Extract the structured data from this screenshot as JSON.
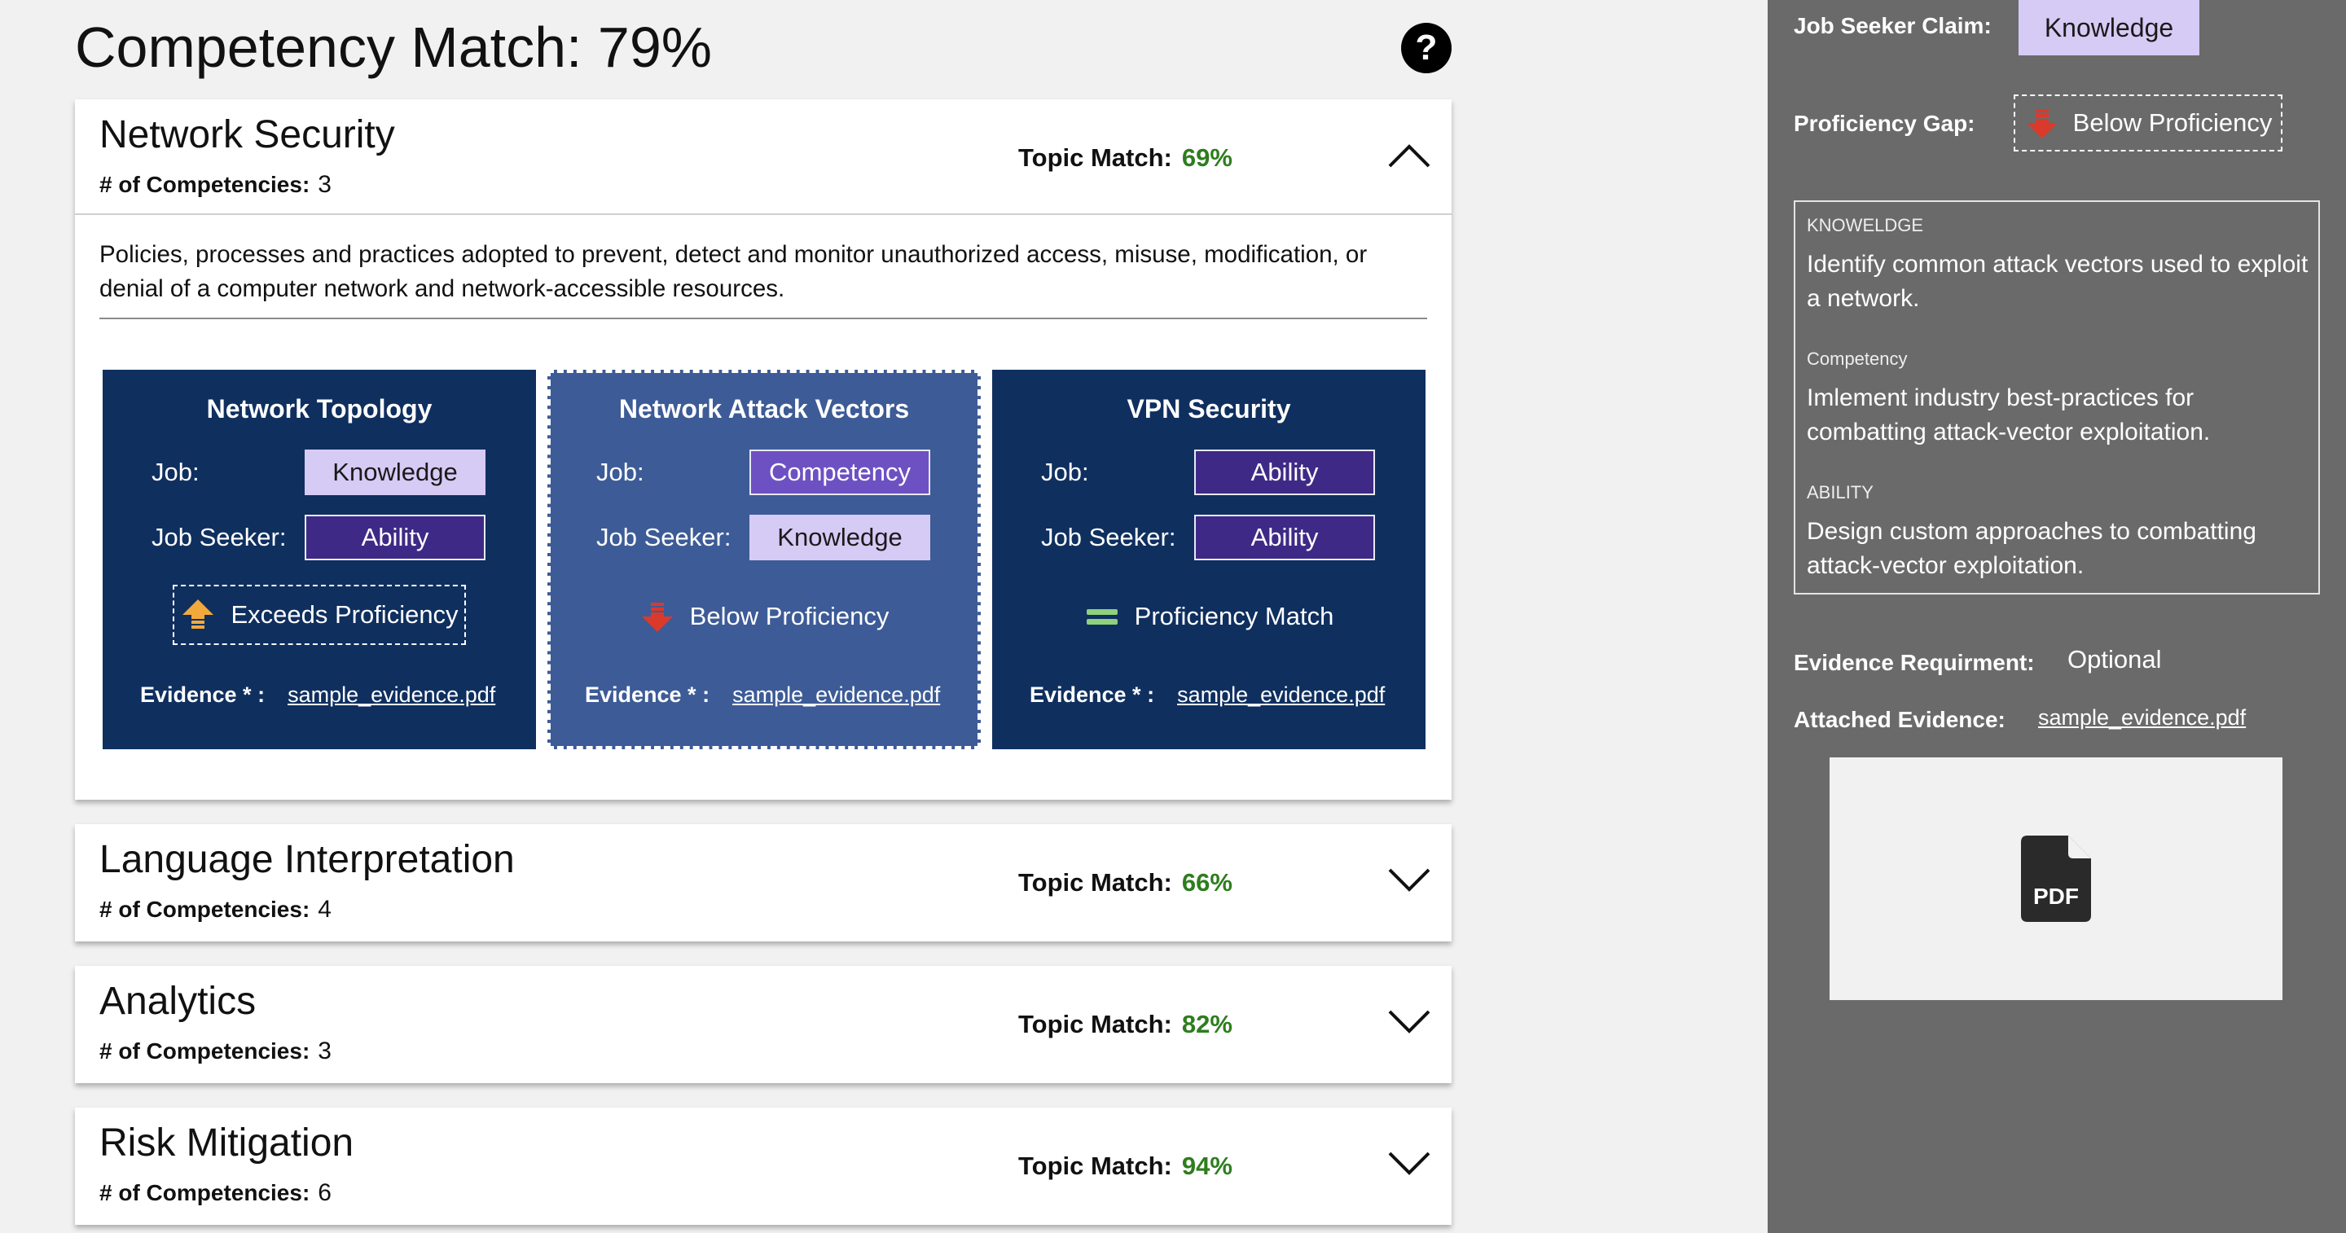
{
  "header": {
    "title": "Competency Match:  79%",
    "help_icon": "?"
  },
  "topics": [
    {
      "name": "Network Security",
      "competencies_label": "# of Competencies:",
      "competencies_count": "3",
      "match_label": "Topic Match:",
      "match_value": "69%",
      "expanded": true,
      "description": "Policies, processes and practices adopted to prevent, detect and monitor unauthorized access, misuse, modification, or denial of a computer network and network-accessible resources.",
      "competencies": [
        {
          "title": "Network Topology",
          "job_label": "Job:",
          "job_value": "Knowledge",
          "seeker_label": "Job Seeker:",
          "seeker_value": "Ability",
          "proficiency": "Exceeds Proficiency",
          "proficiency_icon": "arrow-up-icon",
          "evidence_label": "Evidence * :",
          "evidence_file": "sample_evidence.pdf"
        },
        {
          "title": "Network Attack Vectors",
          "job_label": "Job:",
          "job_value": "Competency",
          "seeker_label": "Job Seeker:",
          "seeker_value": "Knowledge",
          "proficiency": "Below Proficiency",
          "proficiency_icon": "arrow-down-icon",
          "evidence_label": "Evidence * :",
          "evidence_file": "sample_evidence.pdf"
        },
        {
          "title": "VPN Security",
          "job_label": "Job:",
          "job_value": "Ability",
          "seeker_label": "Job Seeker:",
          "seeker_value": "Ability",
          "proficiency": "Proficiency Match",
          "proficiency_icon": "equals-icon",
          "evidence_label": "Evidence * :",
          "evidence_file": "sample_evidence.pdf"
        }
      ]
    },
    {
      "name": "Language Interpretation",
      "competencies_label": "# of Competencies:",
      "competencies_count": "4",
      "match_label": "Topic Match:",
      "match_value": "66%",
      "expanded": false
    },
    {
      "name": "Analytics",
      "competencies_label": "# of Competencies:",
      "competencies_count": "3",
      "match_label": "Topic Match:",
      "match_value": "82%",
      "expanded": false
    },
    {
      "name": "Risk Mitigation",
      "competencies_label": "# of Competencies:",
      "competencies_count": "6",
      "match_label": "Topic Match:",
      "match_value": "94%",
      "expanded": false
    }
  ],
  "side_panel": {
    "claim_label": "Job Seeker Claim:",
    "claim_value": "Knowledge",
    "gap_label": "Proficiency Gap:",
    "gap_value": "Below Proficiency",
    "ksa": [
      {
        "heading": "KNOWELDGE",
        "text": "Identify common attack vectors used to exploit a network."
      },
      {
        "heading": "Competency",
        "text": "Imlement industry best-practices for combatting attack-vector exploitation."
      },
      {
        "heading": "ABILITY",
        "text": "Design custom approaches to combatting attack-vector exploitation."
      }
    ],
    "evidence_req_label": "Evidence Requirment:",
    "evidence_req_value": "Optional",
    "attached_label": "Attached Evidence:",
    "attached_file": "sample_evidence.pdf",
    "preview_icon": "pdf-file-icon",
    "preview_icon_text": "PDF"
  },
  "colors": {
    "match_green": "#2e7d1e",
    "card_navy": "#0f2f5f",
    "card_selected": "#3d5b96",
    "knowledge_chip": "#d6cbf5",
    "ability_chip": "#3e2a86",
    "competency_chip": "#6d51c2",
    "side_panel": "#6a6a6a"
  }
}
